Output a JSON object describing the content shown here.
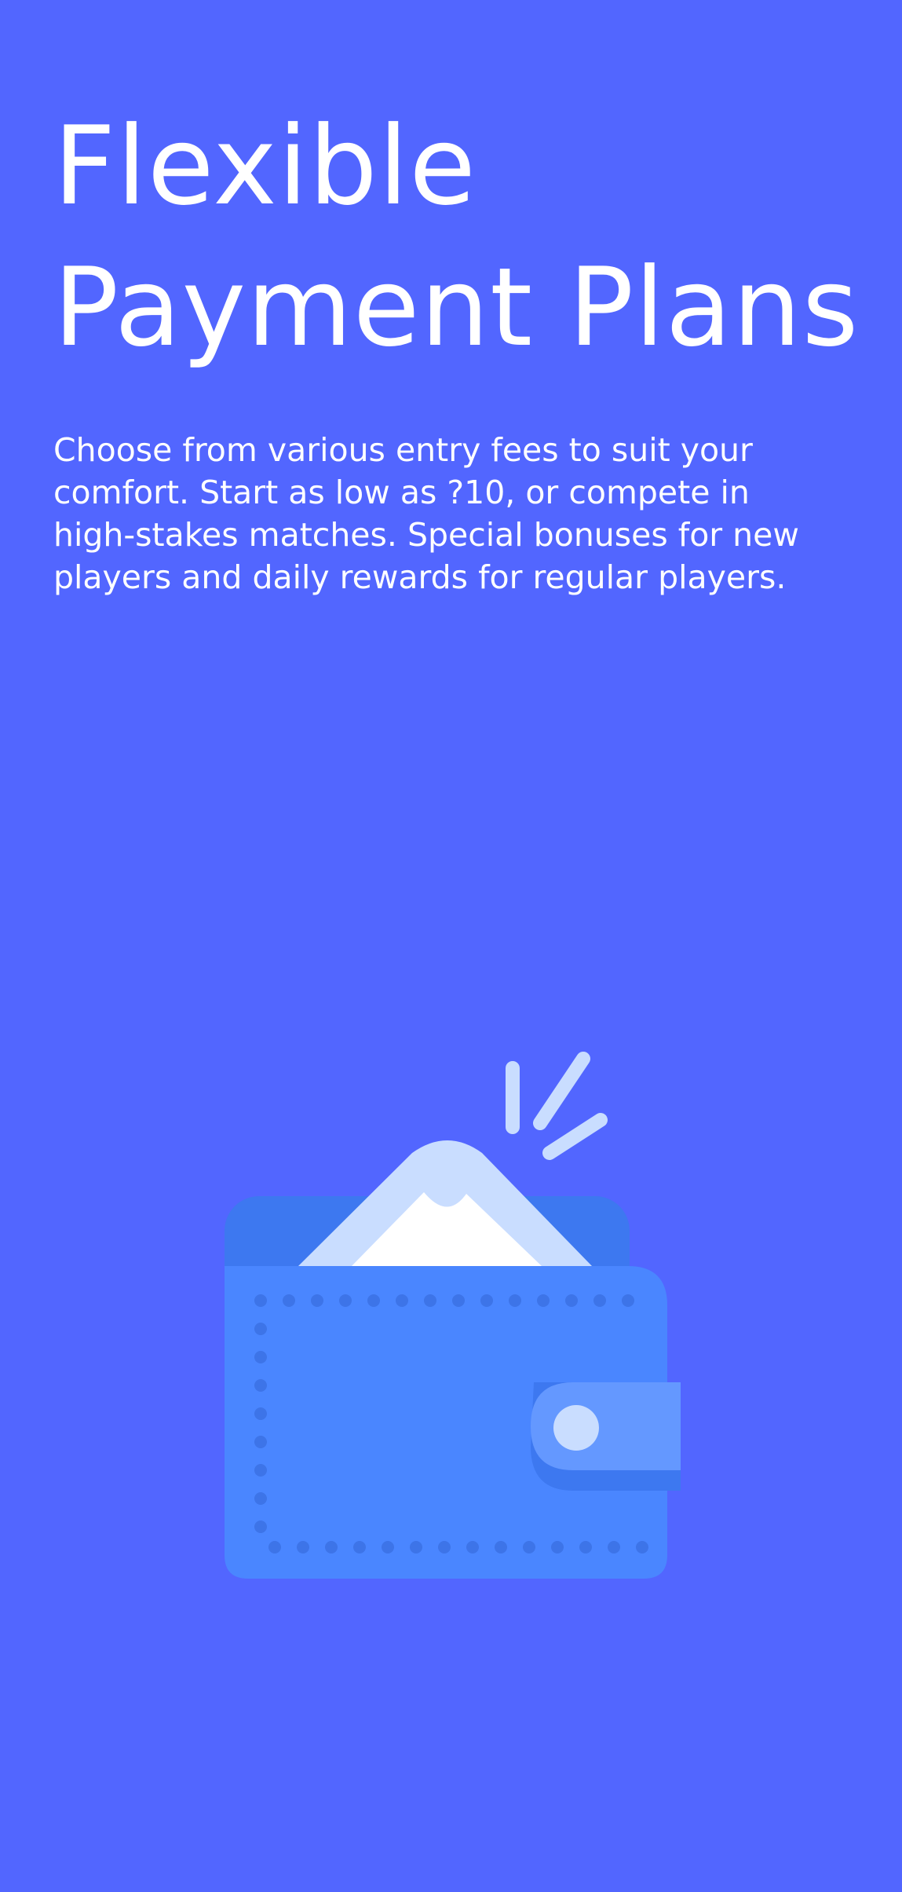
{
  "onboarding": {
    "title_lines": [
      "Flexible",
      "Payment Plans"
    ],
    "description_lines": [
      "Choose from various entry fees to suit your",
      "comfort. Start as low as ?10, or compete in",
      "high-stakes matches. Special bonuses for new",
      "players and daily rewards for regular players."
    ],
    "illustration_icon": "wallet-icon"
  },
  "colors": {
    "background": "#5266ff",
    "text": "#ffffff",
    "wallet_body": "#4a86ff",
    "wallet_back": "#3d78f0",
    "wallet_clasp": "#6498ff",
    "paper": "#c9ddff"
  }
}
